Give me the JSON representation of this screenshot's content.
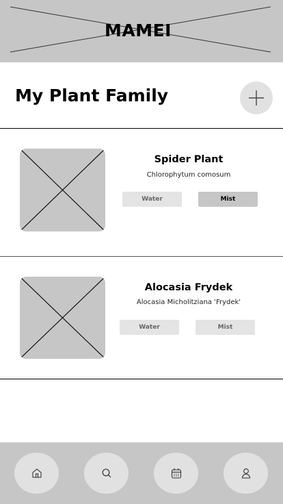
{
  "header": {
    "brand": "MAMEI"
  },
  "page": {
    "title": "My Plant Family",
    "add_icon": "plus-icon"
  },
  "plants": [
    {
      "name": "Spider Plant",
      "scientific": "Chlorophytum comosum",
      "water_label": "Water",
      "mist_label": "Mist",
      "active": "mist"
    },
    {
      "name": "Alocasia Frydek",
      "scientific": "Alocasia Micholitziana 'Frydek'",
      "water_label": "Water",
      "mist_label": "Mist",
      "active": "none"
    }
  ],
  "nav": {
    "items": [
      "home-icon",
      "search-icon",
      "calendar-icon",
      "user-icon"
    ]
  },
  "colors": {
    "placeholder": "#c6c6c6",
    "button_light": "#e4e4e4",
    "button_active": "#c6c6c6"
  }
}
